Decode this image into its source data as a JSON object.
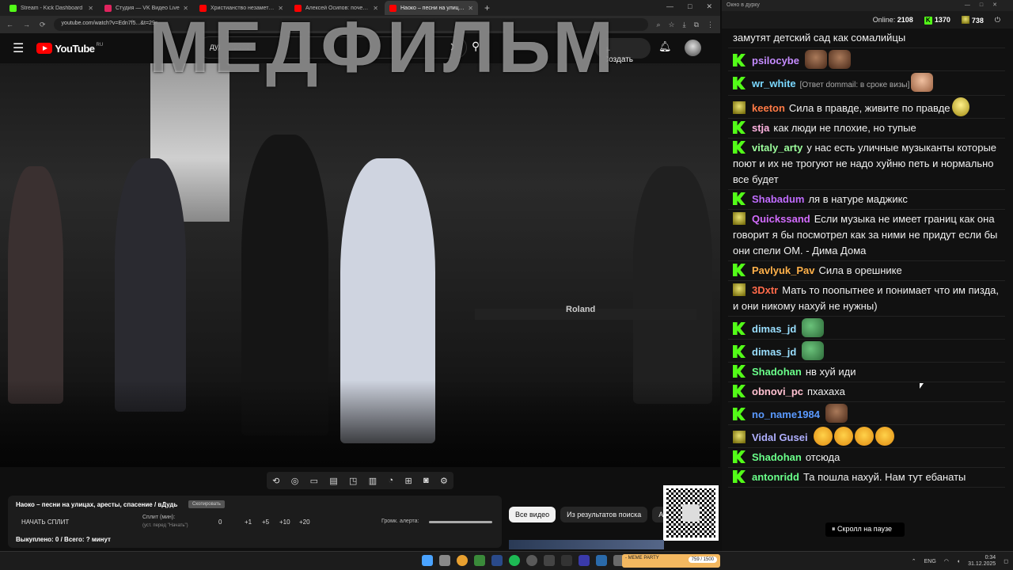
{
  "browser": {
    "tabs": [
      {
        "label": "Stream - Kick Dashboard",
        "color": "#53fc18"
      },
      {
        "label": "Студия — VK Видео Live",
        "color": "#e0245e"
      },
      {
        "label": "Христианство незаметно уход",
        "color": "#ff0000"
      },
      {
        "label": "Алексей Осипов: почему Бог",
        "color": "#ff0000"
      },
      {
        "label": "Наоко – песни на улицах, ",
        "color": "#ff0000",
        "active": true
      }
    ],
    "url": "youtube.com/watch?v=Edn7f5...&t=29s"
  },
  "youtube": {
    "logo": "YouTube",
    "region": "RU",
    "search_value": "дудь наоко",
    "create_label": "Создать"
  },
  "overlay": {
    "watermark": "МЕДФИЛЬМ"
  },
  "video": {
    "sign": "Roland"
  },
  "panel": {
    "title": "Наоко – песни на улицах, аресты, спасение / вДудь",
    "copy_label": "Скопировать",
    "start_label": "НАЧАТЬ СПЛИТ",
    "split_label": "Сплит (мин):",
    "split_sub": "(уст. перед \"Начать\")",
    "split_value": "0",
    "steps": [
      "+1",
      "+5",
      "+10",
      "+20"
    ],
    "alert_label": "Громк. алерта:",
    "bought": "Выкуплено: 0 / Всего: ? минут"
  },
  "chips": [
    "Все видео",
    "Из результатов поиска",
    "Ав"
  ],
  "chat": {
    "window_title": "Окно в дурку",
    "online_label": "Online:",
    "online": "2108",
    "k_count": "1370",
    "d_count": "738",
    "messages": [
      {
        "nick": "",
        "text": "замутят детский сад как сомалийцы",
        "color": "#ffffff",
        "badge": "none"
      },
      {
        "nick": "psilocybe",
        "text": "",
        "color": "#c58cff",
        "badge": "k",
        "emotes": [
          "brown",
          "brown"
        ]
      },
      {
        "nick": "wr_white",
        "text": "",
        "reply": "[Ответ dommail: в сроке визы]",
        "color": "#7ad8ff",
        "badge": "k",
        "emotes": [
          "face"
        ]
      },
      {
        "nick": "keeton",
        "text": "Сила в правде, живите по правде",
        "color": "#ff7a45",
        "badge": "d",
        "emotes": [
          "gold"
        ]
      },
      {
        "nick": "stja",
        "text": "как люди не плохие, но тупые",
        "color": "#ffb3e0",
        "badge": "k"
      },
      {
        "nick": "vitaly_arty",
        "text": "у нас есть уличные музыканты которые поют и их не трогуют не надо хуйню петь и нормально все будет",
        "color": "#9cff9c",
        "badge": "k"
      },
      {
        "nick": "Shabadum",
        "text": "ля в натуре маджикс",
        "color": "#c06cff",
        "badge": "k"
      },
      {
        "nick": "Quickssand",
        "text": "Если музыка не имеет границ как она говорит я бы посмотрел как за ними не придут если бы они спели ОМ. - Дима Дома",
        "color": "#d36cff",
        "badge": "d"
      },
      {
        "nick": "Pavlyuk_Pav",
        "text": "Сила в орешнике",
        "color": "#ffb14a",
        "badge": "k"
      },
      {
        "nick": "3Dxtr",
        "text": "Мать то поопытнее и понимает что им пизда, и они никому нахуй не нужны)",
        "color": "#ff6a4a",
        "badge": "d"
      },
      {
        "nick": "dimas_jd",
        "text": "",
        "color": "#9adfff",
        "badge": "k",
        "emotes": [
          "frog"
        ]
      },
      {
        "nick": "dimas_jd",
        "text": "",
        "color": "#9adfff",
        "badge": "k",
        "emotes": [
          "frog"
        ]
      },
      {
        "nick": "Shadohan",
        "text": "нв хуй иди",
        "color": "#6aff8a",
        "badge": "k"
      },
      {
        "nick": "obnovi_pc",
        "text": "пхахаха",
        "color": "#ffc0d0",
        "badge": "k"
      },
      {
        "nick": "no_name1984",
        "text": "",
        "color": "#5a9aff",
        "badge": "k",
        "emotes": [
          "brown"
        ]
      },
      {
        "nick": "Vidal Gusei",
        "text": "",
        "color": "#b0b0ff",
        "badge": "d",
        "emotes": [
          "cry",
          "cry",
          "cry",
          "cry"
        ]
      },
      {
        "nick": "Shadohan",
        "text": "отсюда",
        "color": "#6aff8a",
        "badge": "k"
      },
      {
        "nick": "antonridd",
        "text": "Та пошла нахуй. Нам тут ебанаты",
        "color": "#6aff8a",
        "badge": "k"
      }
    ],
    "paused_label": "⏸ Скролл на паузе"
  },
  "taskbar": {
    "meme_label": "- МЕМЕ PARTY",
    "meme_count": "759 / 1500",
    "lang": "ENG",
    "time": "0:34",
    "date": "31.12.2025"
  }
}
